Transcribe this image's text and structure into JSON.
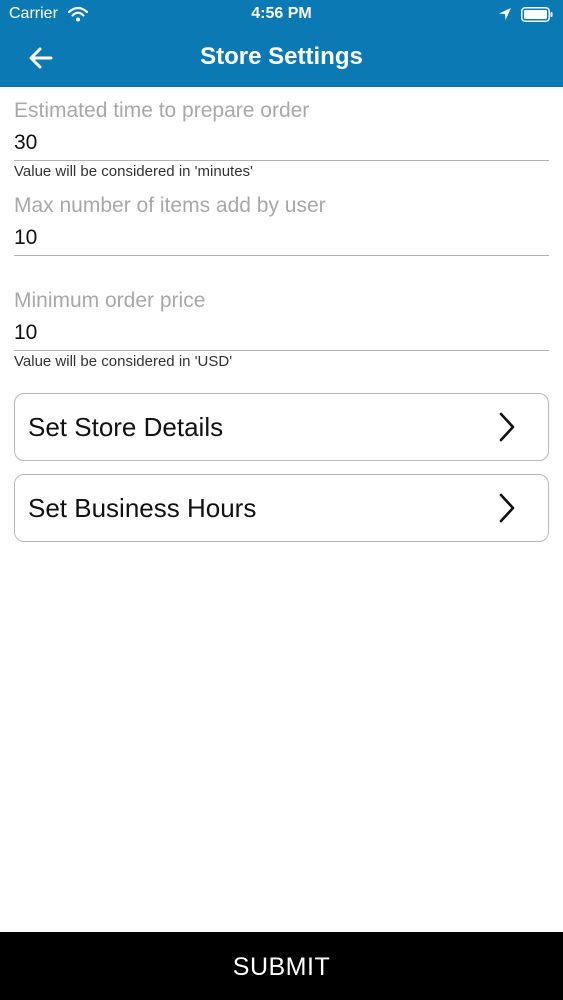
{
  "status_bar": {
    "carrier": "Carrier",
    "time": "4:56 PM",
    "icons": [
      "wifi-icon",
      "location-icon",
      "battery-icon"
    ]
  },
  "header": {
    "title": "Store Settings",
    "back_icon": "arrow-left-icon",
    "background_color": "#0a79b4"
  },
  "fields": [
    {
      "label": "Estimated time to prepare order",
      "value": "30",
      "hint": "Value will be considered in 'minutes'"
    },
    {
      "label": "Max number of items add by user",
      "value": "10",
      "hint": ""
    },
    {
      "label": "Minimum order price",
      "value": "10",
      "hint": "Value will be considered in 'USD'"
    }
  ],
  "links": [
    {
      "label": "Set Store Details",
      "icon": "chevron-right-icon"
    },
    {
      "label": "Set Business Hours",
      "icon": "chevron-right-icon"
    }
  ],
  "submit": {
    "label": "SUBMIT",
    "background_color": "#000000"
  }
}
